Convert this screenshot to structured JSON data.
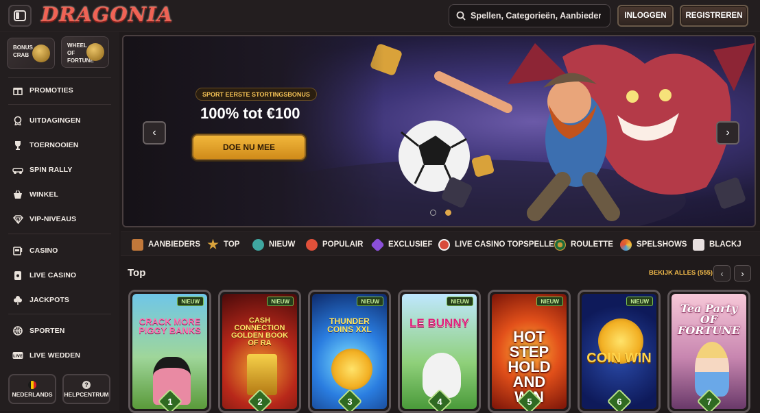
{
  "brand": {
    "logo": "DRAGONIA"
  },
  "header": {
    "search_placeholder": "Spellen, Categorieën, Aanbieders",
    "login": "INLOGGEN",
    "register": "REGISTREREN"
  },
  "sidebar": {
    "promos": [
      {
        "line1": "BONUS",
        "line2": "CRAB",
        "line3": ""
      },
      {
        "line1": "WHEEL",
        "line2": "OF",
        "line3": "FORTUNE"
      }
    ],
    "items": [
      {
        "label": "PROMOTIES",
        "icon": "gift-icon"
      },
      {
        "label": "UITDAGINGEN",
        "icon": "medal-icon"
      },
      {
        "label": "TOERNOOIEN",
        "icon": "trophy-icon"
      },
      {
        "label": "SPIN RALLY",
        "icon": "rally-icon"
      },
      {
        "label": "WINKEL",
        "icon": "basket-icon"
      },
      {
        "label": "VIP-NIVEAUS",
        "icon": "diamond-icon"
      },
      {
        "label": "CASINO",
        "icon": "slot-machine-icon"
      },
      {
        "label": "LIVE CASINO",
        "icon": "card-icon"
      },
      {
        "label": "JACKPOTS",
        "icon": "clover-icon"
      },
      {
        "label": "SPORTEN",
        "icon": "basketball-icon"
      },
      {
        "label": "LIVE WEDDEN",
        "icon": "live-icon"
      }
    ],
    "footer": {
      "language": "NEDERLANDS",
      "help": "HELPCENTRUM"
    }
  },
  "hero": {
    "tag": "SPORT EERSTE STORTINGSBONUS",
    "title": "100% tot €100",
    "cta": "DOE NU MEE"
  },
  "categories": [
    {
      "label": "AANBIEDERS",
      "color": "#c1783a"
    },
    {
      "label": "TOP",
      "color": "#d9a33c"
    },
    {
      "label": "NIEUW",
      "color": "#3fa6a0"
    },
    {
      "label": "POPULAIR",
      "color": "#e0503a"
    },
    {
      "label": "EXCLUSIEF",
      "color": "#8a4fd8"
    },
    {
      "label": "LIVE CASINO TOPSPELLEN",
      "color": "#d84a3a"
    },
    {
      "label": "ROULETTE",
      "color": "#c99a3a"
    },
    {
      "label": "SPELSHOWS",
      "color": "#e06a2a"
    },
    {
      "label": "BLACKJ",
      "color": "#e8e0e0"
    }
  ],
  "top": {
    "title": "Top",
    "see_all": "BEKIJK ALLES (555)",
    "games": [
      {
        "name": "CRACK MORE PIGGY BANKS",
        "badge": "NIEUW",
        "rank": "1"
      },
      {
        "name": "CASH CONNECTION GOLDEN BOOK OF RA",
        "badge": "NIEUW",
        "rank": "2"
      },
      {
        "name": "THUNDER COINS XXL",
        "badge": "NIEUW",
        "rank": "3"
      },
      {
        "name": "LE BUNNY",
        "badge": "NIEUW",
        "rank": "4"
      },
      {
        "name": "HOT STEP HOLD AND WIN",
        "badge": "NIEUW",
        "rank": "5"
      },
      {
        "name": "COIN WIN",
        "badge": "NIEUW",
        "rank": "6"
      },
      {
        "name": "Tea Party OF FORTUNE",
        "badge": "",
        "rank": "7"
      }
    ]
  }
}
